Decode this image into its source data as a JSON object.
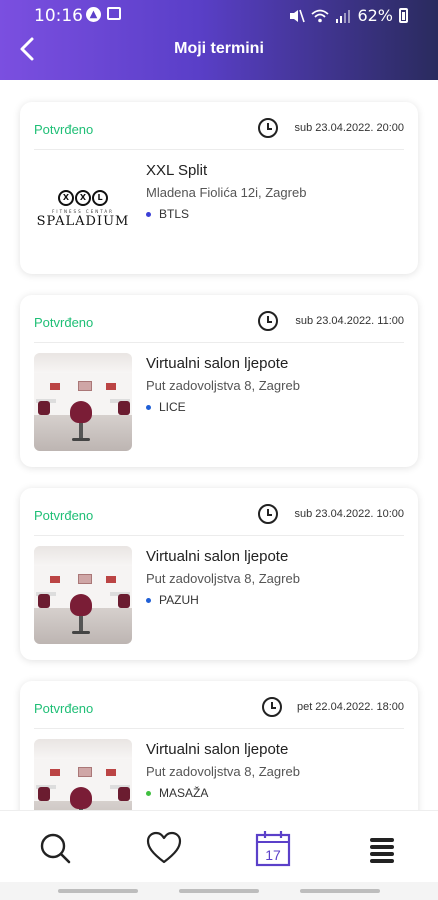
{
  "status_bar": {
    "time": "10:16",
    "battery": "62%"
  },
  "header": {
    "title": "Moji termini",
    "back_icon": "arrow-left-icon"
  },
  "appointments": [
    {
      "status": "Potvrđeno",
      "date": "sub 23.04.2022. 20:00",
      "name": "XXL Split",
      "address": "Mladena Fiolića 12i, Zagreb",
      "service": "BTLS",
      "service_dot_color": "#3b3fd6",
      "thumb": "logo",
      "logo_text": "SPALADIUM",
      "logo_sub": "FITNESS CENTAR",
      "logo_rings": [
        "X",
        "X",
        "L"
      ]
    },
    {
      "status": "Potvrđeno",
      "date": "sub 23.04.2022. 11:00",
      "name": "Virtualni salon ljepote",
      "address": "Put zadovoljstva 8, Zagreb",
      "service": "LICE",
      "service_dot_color": "#1f5fd6",
      "thumb": "photo"
    },
    {
      "status": "Potvrđeno",
      "date": "sub 23.04.2022. 10:00",
      "name": "Virtualni salon ljepote",
      "address": "Put zadovoljstva 8, Zagreb",
      "service": "PAZUH",
      "service_dot_color": "#1f5fd6",
      "thumb": "photo"
    },
    {
      "status": "Potvrđeno",
      "date": "pet 22.04.2022. 18:00",
      "name": "Virtualni salon ljepote",
      "address": "Put zadovoljstva 8, Zagreb",
      "service": "MASAŽA",
      "service_dot_color": "#3fbf3f",
      "thumb": "photo"
    }
  ],
  "bottom_nav": {
    "calendar_day": "17",
    "items": [
      "search-icon",
      "heart-icon",
      "calendar-icon",
      "menu-icon"
    ]
  },
  "colors": {
    "accent": "#5b40c9",
    "status_confirmed": "#1fbf76"
  }
}
